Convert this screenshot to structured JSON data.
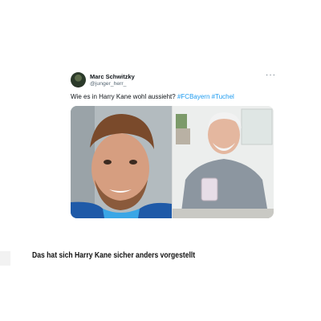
{
  "tweet": {
    "author_name": "Marc Schwitzky",
    "author_handle": "@junger_herr_",
    "text_prefix": "Wie es in Harry Kane wohl aussieht? ",
    "hashtags": [
      "#FCBayern",
      "#Tuchel"
    ],
    "more_icon": "more-horizontal-icon"
  },
  "caption": "Das hat sich Harry Kane sicher anders vorgestellt",
  "colors": {
    "hashtag": "#1d9bf0",
    "name": "#0f1419",
    "secondary_text": "#536471"
  }
}
